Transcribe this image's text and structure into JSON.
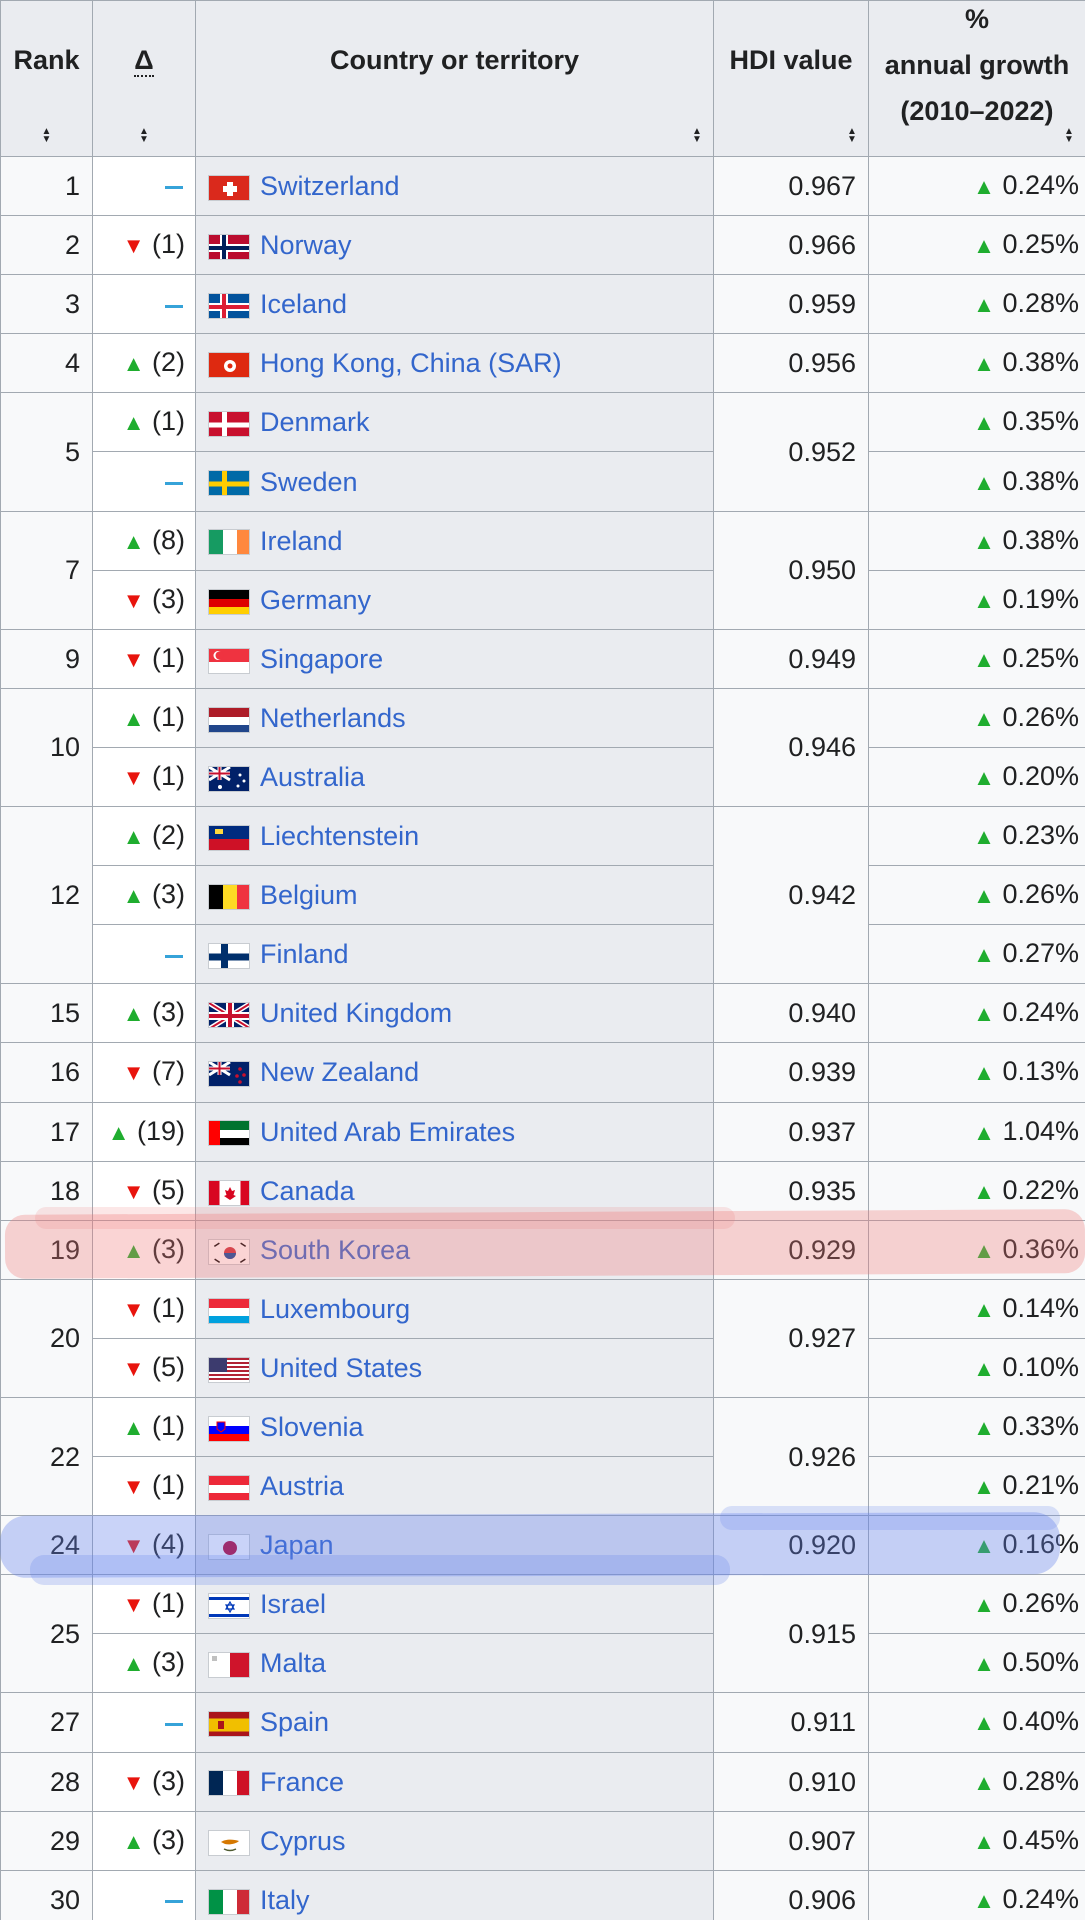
{
  "table": {
    "headers": {
      "rank": "Rank",
      "delta": "Δ",
      "country": "Country or territory",
      "hdi": "HDI value",
      "growth_line1": "%",
      "growth_line2": "annual growth",
      "growth_line3": "(2010–2022)"
    },
    "colors": {
      "header_bg": "#eaecf0",
      "border": "#a2a9b1",
      "link": "#3366cc",
      "up": "#1fad2f",
      "down": "#e8140d",
      "unchanged": "#36a3d9",
      "highlight_red": "#f07878",
      "highlight_blue": "#6482eb"
    },
    "rows": [
      {
        "rank": "1",
        "delta_dir": "same",
        "delta": "",
        "country": "Switzerland",
        "flag": "switzerland-flag",
        "hdi": "0.967",
        "growth": "0.24%"
      },
      {
        "rank": "2",
        "delta_dir": "down",
        "delta": "(1)",
        "country": "Norway",
        "flag": "norway-flag",
        "hdi": "0.966",
        "growth": "0.25%"
      },
      {
        "rank": "3",
        "delta_dir": "same",
        "delta": "",
        "country": "Iceland",
        "flag": "iceland-flag",
        "hdi": "0.959",
        "growth": "0.28%"
      },
      {
        "rank": "4",
        "delta_dir": "up",
        "delta": "(2)",
        "country": "Hong Kong, China (SAR)",
        "flag": "hong-kong-flag",
        "hdi": "0.956",
        "growth": "0.38%"
      },
      {
        "rank": "5",
        "delta_dir": "up",
        "delta": "(1)",
        "country": "Denmark",
        "flag": "denmark-flag",
        "hdi": "0.952",
        "growth": "0.35%"
      },
      {
        "rank": "",
        "delta_dir": "same",
        "delta": "",
        "country": "Sweden",
        "flag": "sweden-flag",
        "hdi": "",
        "growth": "0.38%"
      },
      {
        "rank": "7",
        "delta_dir": "up",
        "delta": "(8)",
        "country": "Ireland",
        "flag": "ireland-flag",
        "hdi": "0.950",
        "growth": "0.38%"
      },
      {
        "rank": "",
        "delta_dir": "down",
        "delta": "(3)",
        "country": "Germany",
        "flag": "germany-flag",
        "hdi": "",
        "growth": "0.19%"
      },
      {
        "rank": "9",
        "delta_dir": "down",
        "delta": "(1)",
        "country": "Singapore",
        "flag": "singapore-flag",
        "hdi": "0.949",
        "growth": "0.25%"
      },
      {
        "rank": "10",
        "delta_dir": "up",
        "delta": "(1)",
        "country": "Netherlands",
        "flag": "netherlands-flag",
        "hdi": "0.946",
        "growth": "0.26%"
      },
      {
        "rank": "",
        "delta_dir": "down",
        "delta": "(1)",
        "country": "Australia",
        "flag": "australia-flag",
        "hdi": "",
        "growth": "0.20%"
      },
      {
        "rank": "12",
        "delta_dir": "up",
        "delta": "(2)",
        "country": "Liechtenstein",
        "flag": "liechtenstein-flag",
        "hdi": "0.942",
        "growth": "0.23%"
      },
      {
        "rank": "",
        "delta_dir": "up",
        "delta": "(3)",
        "country": "Belgium",
        "flag": "belgium-flag",
        "hdi": "",
        "growth": "0.26%"
      },
      {
        "rank": "",
        "delta_dir": "same",
        "delta": "",
        "country": "Finland",
        "flag": "finland-flag",
        "hdi": "",
        "growth": "0.27%"
      },
      {
        "rank": "15",
        "delta_dir": "up",
        "delta": "(3)",
        "country": "United Kingdom",
        "flag": "uk-flag",
        "hdi": "0.940",
        "growth": "0.24%"
      },
      {
        "rank": "16",
        "delta_dir": "down",
        "delta": "(7)",
        "country": "New Zealand",
        "flag": "new-zealand-flag",
        "hdi": "0.939",
        "growth": "0.13%"
      },
      {
        "rank": "17",
        "delta_dir": "up",
        "delta": "(19)",
        "country": "United Arab Emirates",
        "flag": "uae-flag",
        "hdi": "0.937",
        "growth": "1.04%"
      },
      {
        "rank": "18",
        "delta_dir": "down",
        "delta": "(5)",
        "country": "Canada",
        "flag": "canada-flag",
        "hdi": "0.935",
        "growth": "0.22%"
      },
      {
        "rank": "19",
        "delta_dir": "up",
        "delta": "(3)",
        "country": "South Korea",
        "flag": "south-korea-flag",
        "hdi": "0.929",
        "growth": "0.36%"
      },
      {
        "rank": "20",
        "delta_dir": "down",
        "delta": "(1)",
        "country": "Luxembourg",
        "flag": "luxembourg-flag",
        "hdi": "0.927",
        "growth": "0.14%"
      },
      {
        "rank": "",
        "delta_dir": "down",
        "delta": "(5)",
        "country": "United States",
        "flag": "usa-flag",
        "hdi": "",
        "growth": "0.10%"
      },
      {
        "rank": "22",
        "delta_dir": "up",
        "delta": "(1)",
        "country": "Slovenia",
        "flag": "slovenia-flag",
        "hdi": "0.926",
        "growth": "0.33%"
      },
      {
        "rank": "",
        "delta_dir": "down",
        "delta": "(1)",
        "country": "Austria",
        "flag": "austria-flag",
        "hdi": "",
        "growth": "0.21%"
      },
      {
        "rank": "24",
        "delta_dir": "down",
        "delta": "(4)",
        "country": "Japan",
        "flag": "japan-flag",
        "hdi": "0.920",
        "growth": "0.16%"
      },
      {
        "rank": "25",
        "delta_dir": "down",
        "delta": "(1)",
        "country": "Israel",
        "flag": "israel-flag",
        "hdi": "0.915",
        "growth": "0.26%"
      },
      {
        "rank": "",
        "delta_dir": "up",
        "delta": "(3)",
        "country": "Malta",
        "flag": "malta-flag",
        "hdi": "",
        "growth": "0.50%"
      },
      {
        "rank": "27",
        "delta_dir": "same",
        "delta": "",
        "country": "Spain",
        "flag": "spain-flag",
        "hdi": "0.911",
        "growth": "0.40%"
      },
      {
        "rank": "28",
        "delta_dir": "down",
        "delta": "(3)",
        "country": "France",
        "flag": "france-flag",
        "hdi": "0.910",
        "growth": "0.28%"
      },
      {
        "rank": "29",
        "delta_dir": "up",
        "delta": "(3)",
        "country": "Cyprus",
        "flag": "cyprus-flag",
        "hdi": "0.907",
        "growth": "0.45%"
      },
      {
        "rank": "30",
        "delta_dir": "same",
        "delta": "",
        "country": "Italy",
        "flag": "italy-flag",
        "hdi": "0.906",
        "growth": "0.24%"
      }
    ]
  }
}
